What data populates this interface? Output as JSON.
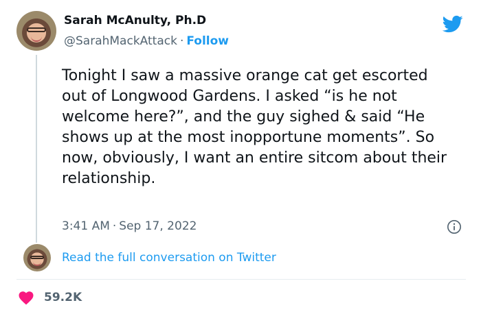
{
  "author": {
    "name": "Sarah McAnulty, Ph.D",
    "handle": "@SarahMackAttack",
    "separator": "·",
    "follow_label": "Follow"
  },
  "tweet": {
    "text": "Tonight I saw a massive orange cat get escorted out of Longwood Gardens. I asked “is he not welcome here?”, and the guy sighed & said “He shows up at the most inopportune moments”. So now, obviously, I want an entire sitcom about their relationship.",
    "time": "3:41 AM",
    "separator": "·",
    "date": "Sep 17, 2022"
  },
  "conversation_link": "Read the full conversation on Twitter",
  "engagement": {
    "likes": "59.2K"
  },
  "icons": {
    "brand": "twitter-bird-icon",
    "info": "info-icon",
    "like": "heart-icon"
  },
  "colors": {
    "accent": "#1d9bf0",
    "text": "#0f1419",
    "muted": "#536471",
    "like": "#f91880"
  }
}
